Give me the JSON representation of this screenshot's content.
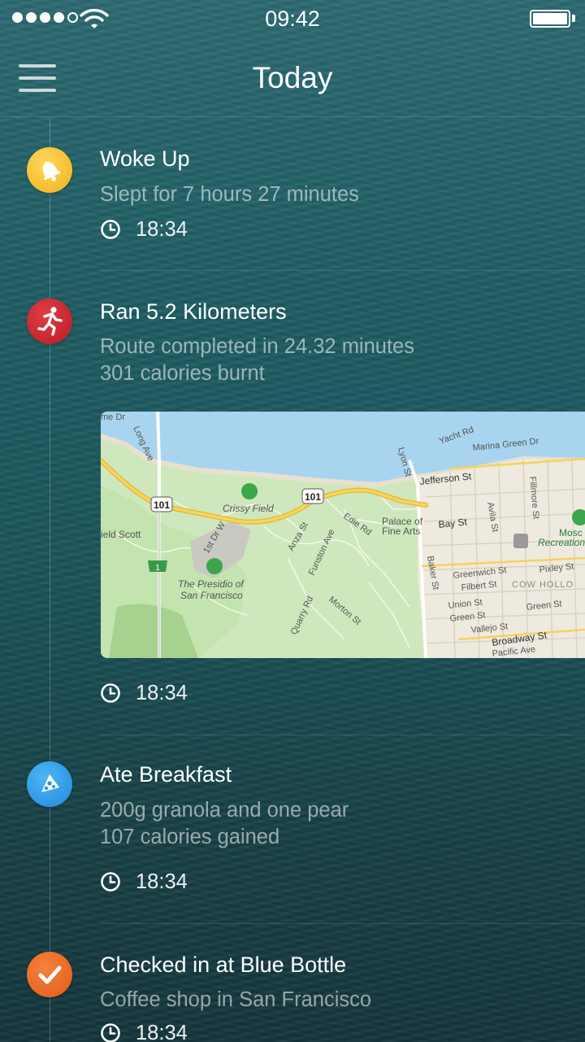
{
  "status_bar": {
    "time": "09:42",
    "signal_bars": 4,
    "signal_total": 5,
    "battery_level": 1.0,
    "icons": [
      "signal-dots",
      "wifi-icon",
      "battery-icon"
    ]
  },
  "nav": {
    "title": "Today",
    "menu_icon": "hamburger-menu-icon"
  },
  "entries": [
    {
      "title": "Woke Up",
      "subtitle": "Slept for 7 hours 27 minutes",
      "time": "18:34",
      "icon": "bell-icon",
      "color": "#f5c229"
    },
    {
      "title": "Ran 5.2 Kilometers",
      "subtitle": "Route completed in 24.32 minutes",
      "subtitle2": "301 calories burnt",
      "time": "18:34",
      "icon": "running-icon",
      "color": "#d2242c",
      "map": {
        "labels": {
          "long_ave": "Long Ave",
          "crissy_field": "Crissy Field",
          "hwy1": "101",
          "hwy2": "101",
          "hwy3": "1",
          "field_scott": "ield Scott",
          "presidio_1": "The Presidio of",
          "presidio_2": "San Francisco",
          "first_dr": "1st Dr W",
          "anza": "Anza St",
          "funston": "Funston Ave",
          "edie": "Edie Rd",
          "quarry": "Quarry Rd",
          "morton": "Morton St",
          "lyon": "Lyon St",
          "palace_1": "Palace of",
          "palace_2": "Fine Arts",
          "yacht": "Yacht Rd",
          "marina_green": "Marina Green Dr",
          "jefferson": "Jefferson St",
          "bay": "Bay St",
          "avila": "Avila St",
          "fillmore": "Fillmore St",
          "mosc_1": "Mosc",
          "mosc_2": "Recreation",
          "baker": "Baker St",
          "greenwich": "Greenwich St",
          "filbert": "Filbert St",
          "cow_hollow": "COW HOLLO",
          "pixley": "Pixley St",
          "union": "Union St",
          "green1": "Green St",
          "green2": "Green St",
          "vallejo": "Vallejo St",
          "broadway": "Broadway St",
          "pacific": "Pacific Ave",
          "me_dr": "me Dr"
        }
      }
    },
    {
      "title": "Ate Breakfast",
      "subtitle": "200g granola and one pear",
      "subtitle2": "107 calories gained",
      "time": "18:34",
      "icon": "pizza-icon",
      "color": "#2f9ded"
    },
    {
      "title": "Checked in at Blue Bottle",
      "subtitle": "Coffee shop in San Francisco",
      "time": "18:34",
      "icon": "checkmark-icon",
      "color": "#f06b26"
    }
  ]
}
